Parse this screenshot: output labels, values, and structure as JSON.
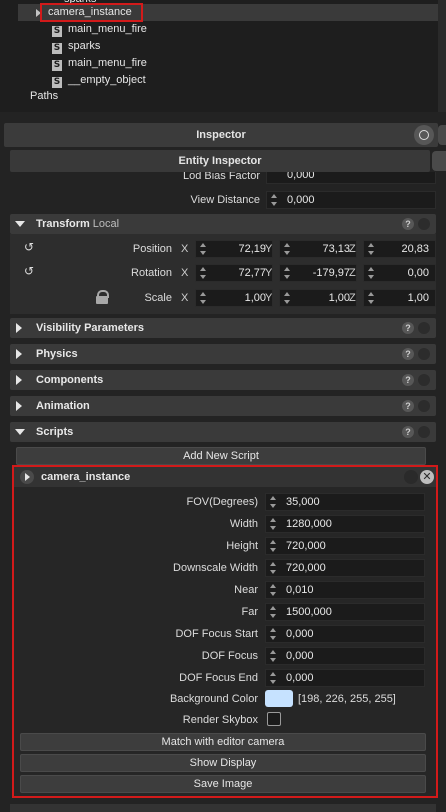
{
  "tree": {
    "items": [
      {
        "label": "sparks"
      },
      {
        "label": "camera_instance"
      },
      {
        "label": "main_menu_fire"
      },
      {
        "label": "sparks"
      },
      {
        "label": "main_menu_fire"
      },
      {
        "label": "__empty_object"
      }
    ],
    "paths_label": "Paths"
  },
  "inspector": {
    "title": "Inspector",
    "entity_title": "Entity Inspector"
  },
  "lod": {
    "label": "Lod Bias Factor",
    "value": "0,000"
  },
  "view_distance": {
    "label": "View Distance",
    "value": "0,000"
  },
  "transform": {
    "title": "Transform",
    "mode": "Local",
    "position": {
      "label": "Position",
      "x": "72,19",
      "y": "73,13",
      "z": "20,83"
    },
    "rotation": {
      "label": "Rotation",
      "x": "72,77",
      "y": "-179,97",
      "z": "0,00"
    },
    "scale": {
      "label": "Scale",
      "x": "1,00",
      "y": "1,00",
      "z": "1,00"
    },
    "axis": {
      "x": "X",
      "y": "Y",
      "z": "Z"
    }
  },
  "sections": {
    "visibility": "Visibility Parameters",
    "physics": "Physics",
    "components": "Components",
    "animation": "Animation",
    "scripts": "Scripts"
  },
  "help_glyph": "?",
  "add_script": "Add New Script",
  "camera": {
    "title": "camera_instance",
    "fov": {
      "label": "FOV(Degrees)",
      "value": "35,000"
    },
    "width": {
      "label": "Width",
      "value": "1280,000"
    },
    "height": {
      "label": "Height",
      "value": "720,000"
    },
    "downscale": {
      "label": "Downscale Width",
      "value": "720,000"
    },
    "near": {
      "label": "Near",
      "value": "0,010"
    },
    "far": {
      "label": "Far",
      "value": "1500,000"
    },
    "dof_start": {
      "label": "DOF Focus Start",
      "value": "0,000"
    },
    "dof_focus": {
      "label": "DOF Focus",
      "value": "0,000"
    },
    "dof_end": {
      "label": "DOF Focus End",
      "value": "0,000"
    },
    "bg": {
      "label": "Background Color",
      "value": "[198, 226, 255, 255]",
      "swatch": "#c6e2ff"
    },
    "skybox": {
      "label": "Render Skybox",
      "checked": false
    },
    "match_btn": "Match with editor camera",
    "show_btn": "Show Display",
    "save_btn": "Save Image"
  },
  "colors": {
    "highlight": "#d21a1a",
    "panel": "#3a3a3a",
    "field": "#1b1b1b"
  }
}
